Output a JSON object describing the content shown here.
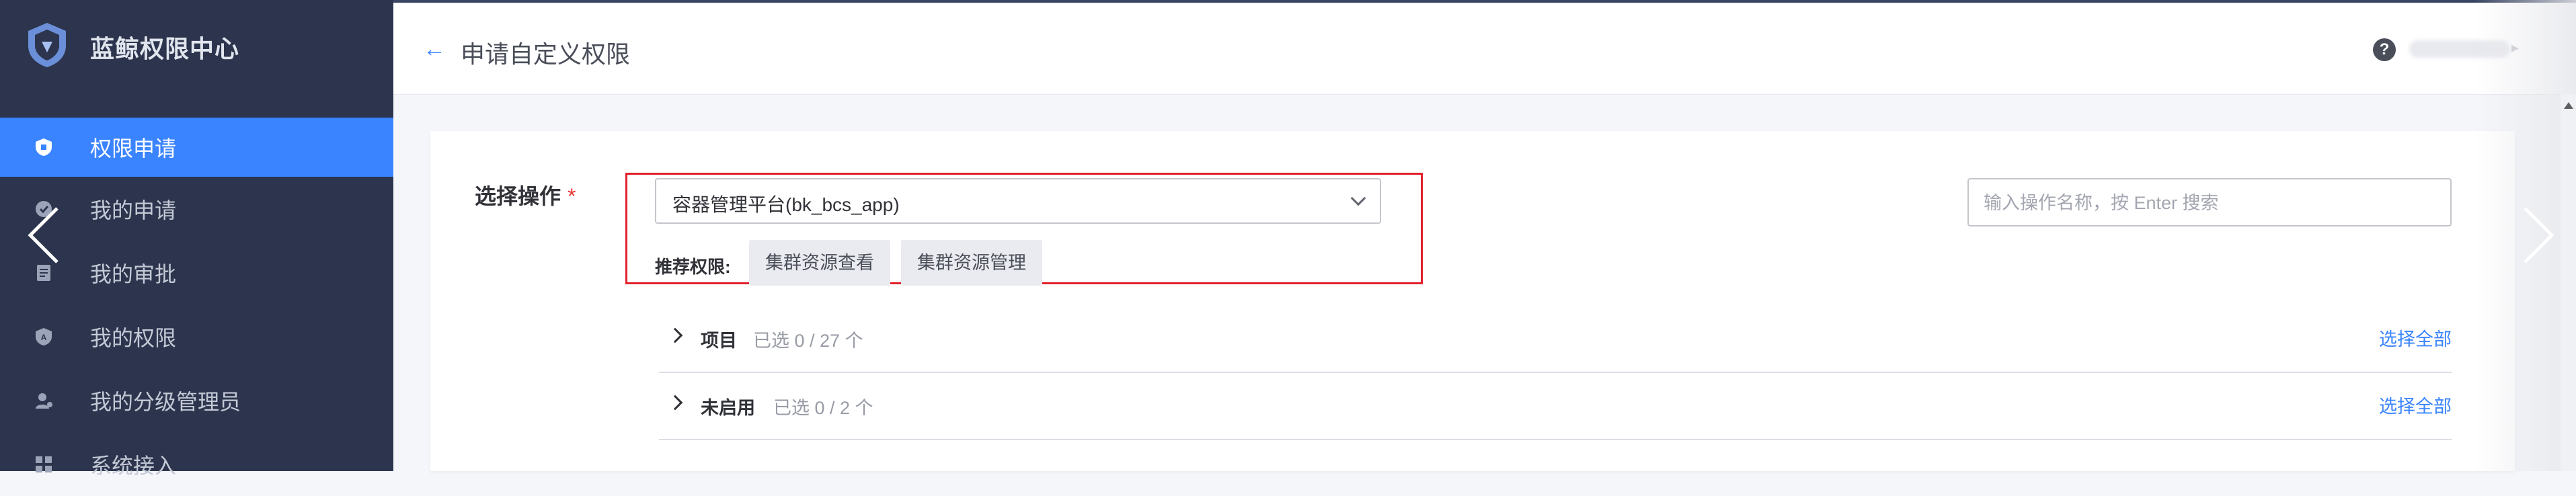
{
  "app": {
    "name": "蓝鲸权限中心",
    "accent": "#3a84ff",
    "sidebar_bg": "#2c354d"
  },
  "sidebar": {
    "items": [
      {
        "label": "权限申请",
        "icon": "apply-icon",
        "active": true
      },
      {
        "label": "我的申请",
        "icon": "my-apply-icon",
        "active": false
      },
      {
        "label": "我的审批",
        "icon": "approval-icon",
        "active": false
      },
      {
        "label": "我的权限",
        "icon": "my-permission-icon",
        "active": false
      },
      {
        "label": "我的分级管理员",
        "icon": "grade-admin-icon",
        "active": false
      },
      {
        "label": "系统接入",
        "icon": "system-access-icon",
        "active": false
      }
    ]
  },
  "header": {
    "back_icon": "back-arrow-icon",
    "title": "申请自定义权限",
    "help_icon": "help-icon"
  },
  "form": {
    "operation_label": "选择操作",
    "required_mark": "*",
    "system_select": {
      "value": "容器管理平台(bk_bcs_app)"
    },
    "recommend_label": "推荐权限:",
    "recommend_tags": [
      "集群资源查看",
      "集群资源管理"
    ],
    "search": {
      "placeholder": "输入操作名称，按 Enter 搜索",
      "value": ""
    },
    "groups": [
      {
        "name": "项目",
        "count_text": "已选 0 / 27 个",
        "select_all": "选择全部"
      },
      {
        "name": "未启用",
        "count_text": "已选 0 / 2 个",
        "select_all": "选择全部"
      }
    ]
  }
}
